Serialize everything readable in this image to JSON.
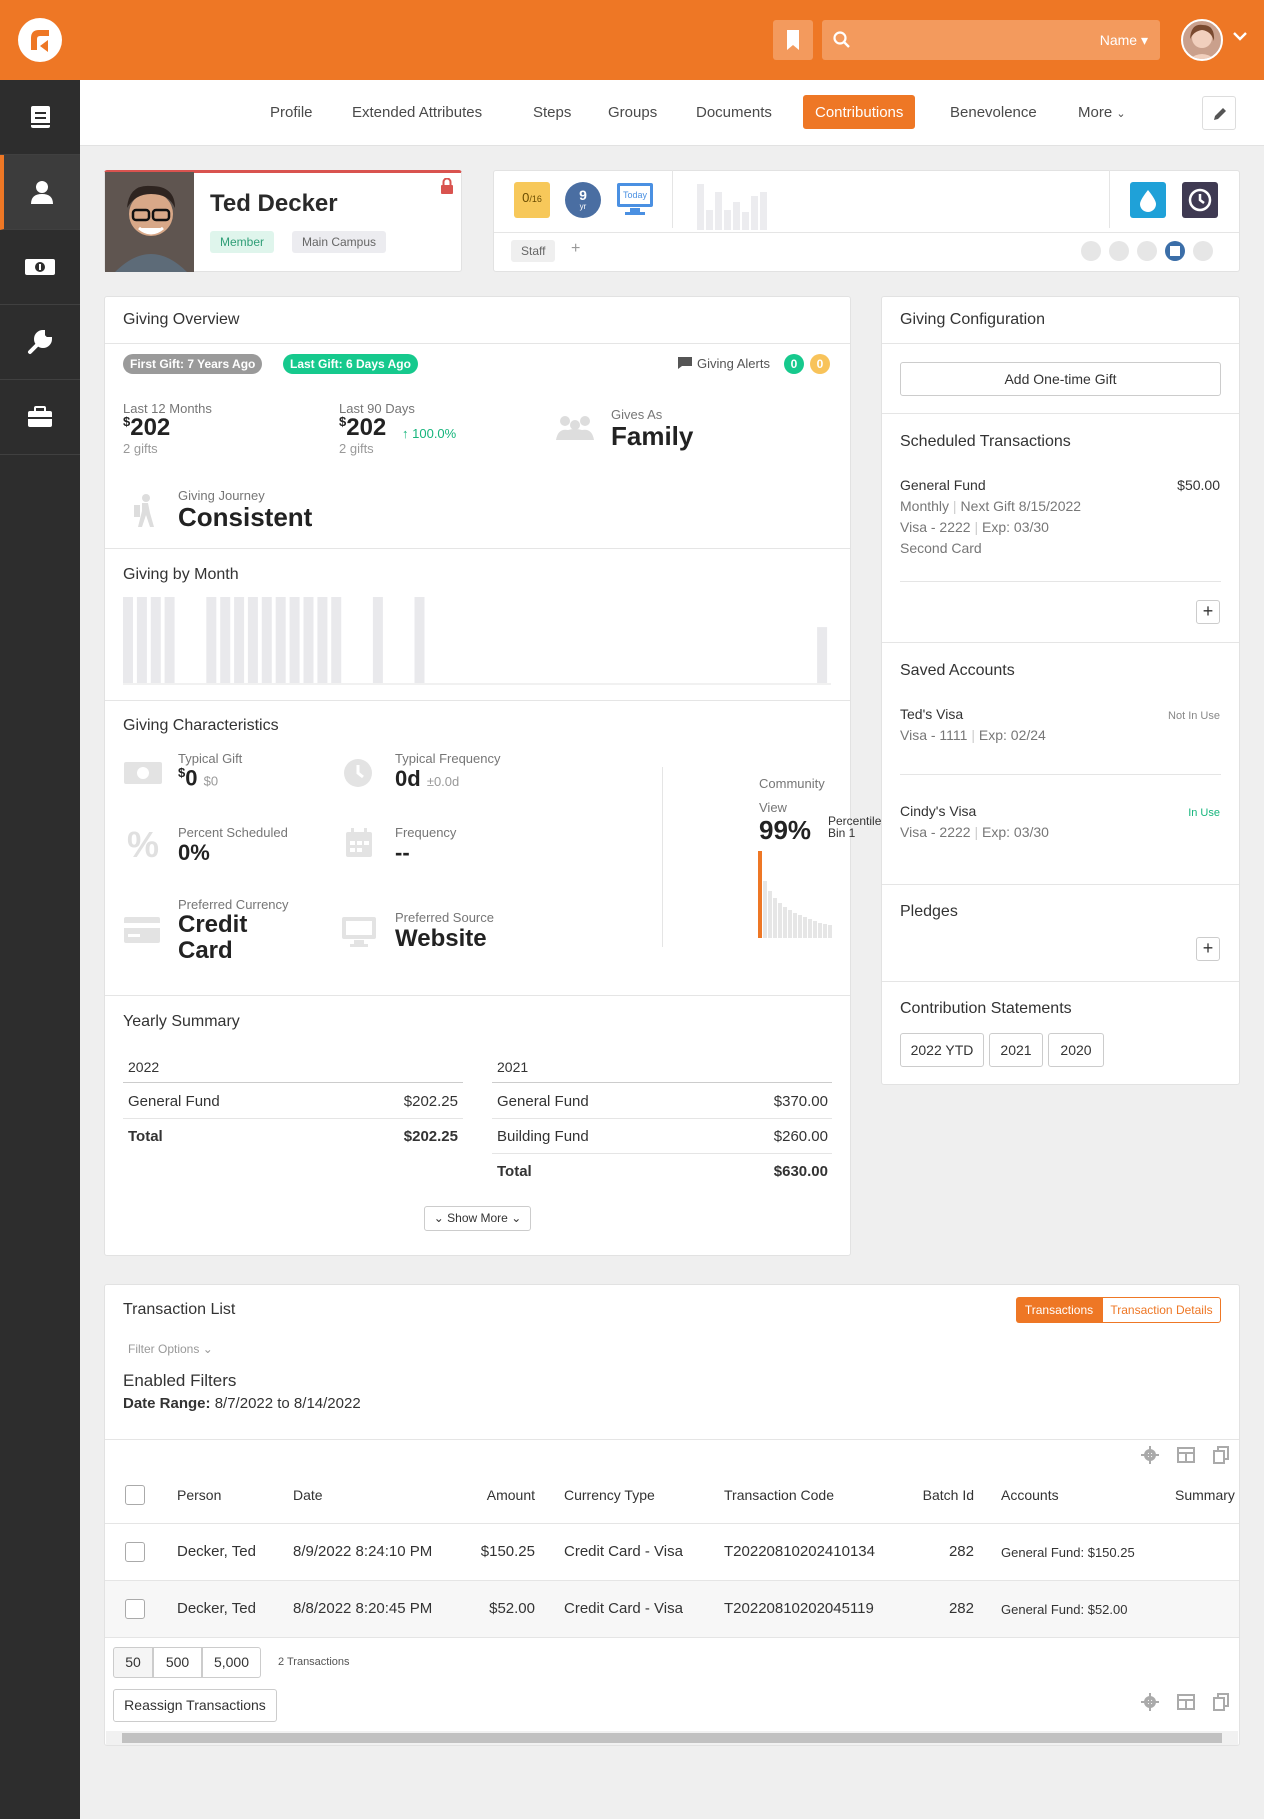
{
  "header": {
    "search_label": "Name"
  },
  "tabs": [
    "Profile",
    "Extended Attributes",
    "Steps",
    "Groups",
    "Documents",
    "Contributions",
    "Benevolence",
    "More"
  ],
  "person": {
    "name": "Ted Decker",
    "status": "Member",
    "campus": "Main Campus"
  },
  "badges": {
    "steps": "0",
    "steps_total": "/16",
    "years": "9",
    "years_unit": "yr",
    "today": "Today",
    "tag": "Staff",
    "plus": "+"
  },
  "overview": {
    "title": "Giving Overview",
    "first_gift": "First Gift: 7 Years Ago",
    "last_gift": "Last Gift: 6 Days Ago",
    "alerts_label": "Giving Alerts",
    "alerts_a": "0",
    "alerts_b": "0",
    "last12_label": "Last 12 Months",
    "last12_value": "202",
    "last12_gifts": "2 gifts",
    "last90_label": "Last 90 Days",
    "last90_value": "202",
    "last90_gifts": "2 gifts",
    "last90_change": "100.0%",
    "gives_as_label": "Gives As",
    "gives_as": "Family",
    "journey_label": "Giving Journey",
    "journey": "Consistent",
    "currency_symbol": "$"
  },
  "by_month": {
    "title": "Giving by Month",
    "values": [
      1,
      1,
      1,
      1,
      0,
      0,
      1,
      1,
      1,
      1,
      1,
      1,
      1,
      1,
      1,
      1,
      0,
      0,
      1,
      0,
      0,
      1,
      0,
      0,
      0,
      0,
      0,
      0,
      0,
      0,
      0,
      0,
      0,
      0,
      0,
      0,
      0,
      0,
      0,
      0,
      0,
      0,
      0,
      0,
      0,
      0,
      0,
      0,
      0,
      0,
      0.65
    ],
    "colors": {
      "bar": "#e9e9ec"
    }
  },
  "characteristics": {
    "title": "Giving Characteristics",
    "typical_gift_label": "Typical Gift",
    "typical_gift": "0",
    "typical_gift_sub": "$0",
    "typical_freq_label": "Typical Frequency",
    "typical_freq": "0d",
    "typical_freq_sub": "±0.0d",
    "pct_sched_label": "Percent Scheduled",
    "pct_sched": "0%",
    "freq_label": "Frequency",
    "freq": "--",
    "pref_currency_label": "Preferred Currency",
    "pref_currency": "Credit Card",
    "pref_source_label": "Preferred Source",
    "pref_source": "Website",
    "community_label": "Community View",
    "community_pct": "99%",
    "community_bin": "Percentile Bin 1"
  },
  "yearly": {
    "title": "Yearly Summary",
    "y1": {
      "year": "2022",
      "rows": [
        [
          "General Fund",
          "$202.25"
        ]
      ],
      "total": [
        "Total",
        "$202.25"
      ]
    },
    "y2": {
      "year": "2021",
      "rows": [
        [
          "General Fund",
          "$370.00"
        ],
        [
          "Building Fund",
          "$260.00"
        ]
      ],
      "total": [
        "Total",
        "$630.00"
      ]
    },
    "show_more": "Show More"
  },
  "config": {
    "title": "Giving Configuration",
    "add_gift": "Add One-time Gift",
    "sched_title": "Scheduled Transactions",
    "sched": {
      "fund": "General Fund",
      "amount": "$50.00",
      "freq": "Monthly",
      "next": "Next Gift 8/15/2022",
      "card": "Visa - 2222",
      "exp": "Exp: 03/30",
      "name": "Second Card"
    },
    "saved_title": "Saved Accounts",
    "acct1": {
      "name": "Ted's Visa",
      "card": "Visa - 1111",
      "exp": "Exp: 02/24",
      "status": "Not In Use"
    },
    "acct2": {
      "name": "Cindy's Visa",
      "card": "Visa - 2222",
      "exp": "Exp: 03/30",
      "status": "In Use"
    },
    "pledges_title": "Pledges",
    "statements_title": "Contribution Statements",
    "statements": [
      "2022 YTD",
      "2021",
      "2020"
    ]
  },
  "transactions": {
    "title": "Transaction List",
    "toggle_a": "Transactions",
    "toggle_b": "Transaction Details",
    "filter_options": "Filter Options",
    "enabled_filters": "Enabled Filters",
    "date_range_label": "Date Range:",
    "date_range": "8/7/2022 to 8/14/2022",
    "headers": [
      "Person",
      "Date",
      "Amount",
      "Currency Type",
      "Transaction Code",
      "Batch Id",
      "Accounts",
      "Summary"
    ],
    "rows": [
      [
        "Decker, Ted",
        "8/9/2022 8:24:10 PM",
        "$150.25",
        "Credit Card - Visa",
        "T20220810202410134",
        "282",
        "General Fund: $150.25"
      ],
      [
        "Decker, Ted",
        "8/8/2022 8:20:45 PM",
        "$52.00",
        "Credit Card - Visa",
        "T20220810202045119",
        "282",
        "General Fund: $52.00"
      ]
    ],
    "page_sizes": [
      "50",
      "500",
      "5,000"
    ],
    "count": "2 Transactions",
    "reassign": "Reassign Transactions"
  }
}
